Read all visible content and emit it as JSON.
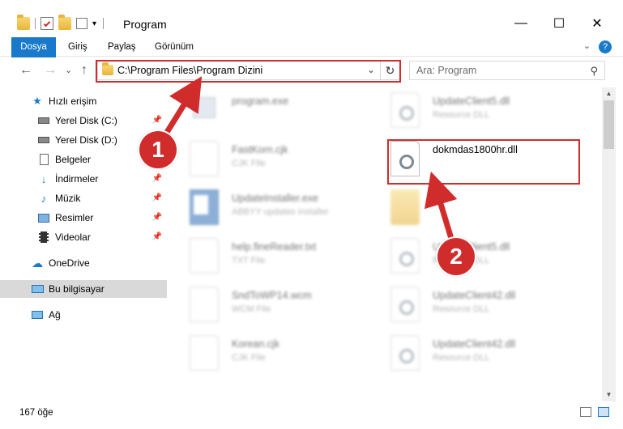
{
  "window": {
    "title": "Program",
    "minimize_glyph": "—",
    "maximize_glyph": "☐",
    "close_glyph": "✕"
  },
  "ribbon": {
    "tabs": [
      {
        "label": "Dosya"
      },
      {
        "label": "Giriş"
      },
      {
        "label": "Paylaş"
      },
      {
        "label": "Görünüm"
      }
    ],
    "expand_glyph": "⌄",
    "help_glyph": "?"
  },
  "address": {
    "path": "C:\\Program Files\\Program Dizini",
    "back_glyph": "←",
    "forward_glyph": "→",
    "recent_glyph": "⌄",
    "up_glyph": "↑",
    "dropdown_glyph": "⌄",
    "refresh_glyph": "↻"
  },
  "search": {
    "placeholder": "Ara: Program",
    "icon_glyph": "⚲"
  },
  "sidebar": {
    "items": [
      {
        "label": "Hızlı erişim",
        "icon": "star-icon"
      },
      {
        "label": "Yerel Disk (C:)",
        "icon": "drive-icon"
      },
      {
        "label": "Yerel Disk (D:)",
        "icon": "drive-icon"
      },
      {
        "label": "Belgeler",
        "icon": "documents-icon"
      },
      {
        "label": "İndirmeler",
        "icon": "download-icon"
      },
      {
        "label": "Müzik",
        "icon": "music-icon"
      },
      {
        "label": "Resimler",
        "icon": "pictures-icon"
      },
      {
        "label": "Videolar",
        "icon": "videos-icon"
      },
      {
        "label": "OneDrive",
        "icon": "cloud-icon"
      },
      {
        "label": "Bu bilgisayar",
        "icon": "computer-icon"
      },
      {
        "label": "Ağ",
        "icon": "network-icon"
      }
    ]
  },
  "files": [
    {
      "name": "program.exe",
      "type": ""
    },
    {
      "name": "UpdateClient5.dll",
      "type": "Resource DLL"
    },
    {
      "name": "FastKorn.cjk",
      "type": "CJK File"
    },
    {
      "name": "dokmdas1800hr.dll",
      "type": ""
    },
    {
      "name": "UpdateInstaller.exe",
      "type": "ABBYY updates installer"
    },
    {
      "name": "help.fineReader.txt",
      "type": "TXT File"
    },
    {
      "name": "UpdateClient5.dll",
      "type": "Resource DLL"
    },
    {
      "name": "SndToWP14.wcm",
      "type": "WCM File"
    },
    {
      "name": "UpdateClient42.dll",
      "type": "Resource DLL"
    },
    {
      "name": "Korean.cjk",
      "type": "CJK File"
    },
    {
      "name": "UpdateClient42.dll",
      "type": "Resource DLL"
    }
  ],
  "status": {
    "item_count": "167 öğe"
  },
  "callouts": [
    {
      "number": "1"
    },
    {
      "number": "2"
    }
  ],
  "colors": {
    "accent": "#1979ca",
    "highlight": "#d12c2c"
  }
}
